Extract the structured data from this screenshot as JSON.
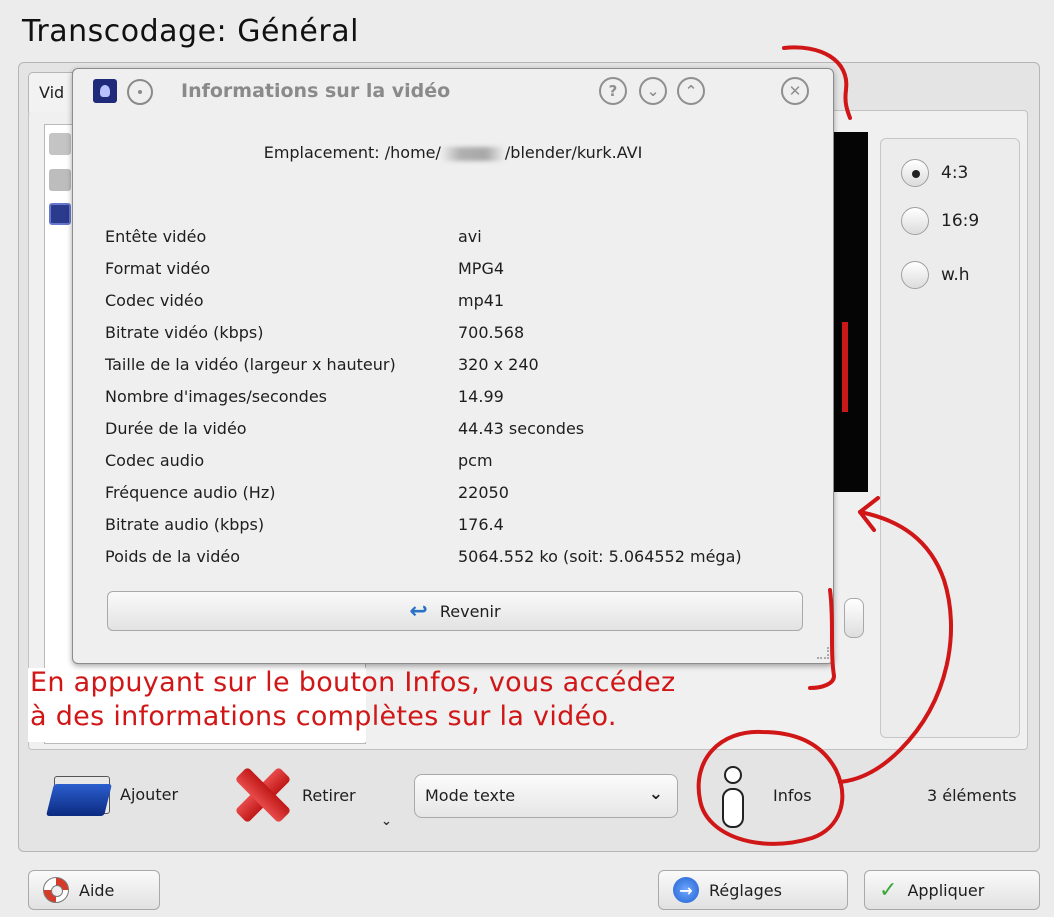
{
  "window": {
    "title": "Transcodage: Général"
  },
  "tab": {
    "label": "Vid"
  },
  "ratio": {
    "options": [
      {
        "label": "4:3",
        "checked": true
      },
      {
        "label": "16:9",
        "checked": false
      },
      {
        "label": "w.h",
        "checked": false
      }
    ]
  },
  "dialog": {
    "title": "Informations sur la vidéo",
    "location_prefix": "Emplacement: /home/",
    "location_suffix": "/blender/kurk.AVI",
    "rows": [
      {
        "label": "Entête vidéo",
        "value": "avi"
      },
      {
        "label": "Format vidéo",
        "value": "MPG4"
      },
      {
        "label": "Codec vidéo",
        "value": "mp41"
      },
      {
        "label": "Bitrate vidéo (kbps)",
        "value": "700.568"
      },
      {
        "label": "Taille de la vidéo (largeur x hauteur)",
        "value": "320 x 240"
      },
      {
        "label": "Nombre d'images/secondes",
        "value": "14.99"
      },
      {
        "label": "Durée de la vidéo",
        "value": "44.43 secondes"
      },
      {
        "label": "Codec audio",
        "value": "pcm"
      },
      {
        "label": "Fréquence audio (Hz)",
        "value": "22050"
      },
      {
        "label": "Bitrate audio (kbps)",
        "value": "176.4"
      },
      {
        "label": "Poids de la vidéo",
        "value": "5064.552 ko (soit: 5.064552 méga)"
      }
    ],
    "back_button": "Revenir"
  },
  "annotation": {
    "line1": "En appuyant sur le bouton Infos, vous accédez",
    "line2": "à des informations complètes sur la vidéo."
  },
  "toolbar": {
    "add": "Ajouter",
    "remove": "Retirer",
    "mode_select": "Mode texte",
    "infos": "Infos",
    "count": "3 éléments"
  },
  "buttons": {
    "help": "Aide",
    "settings": "Réglages",
    "apply": "Appliquer"
  },
  "colors": {
    "annotation": "#d01616",
    "background": "#ececec",
    "preview": "#050505"
  }
}
